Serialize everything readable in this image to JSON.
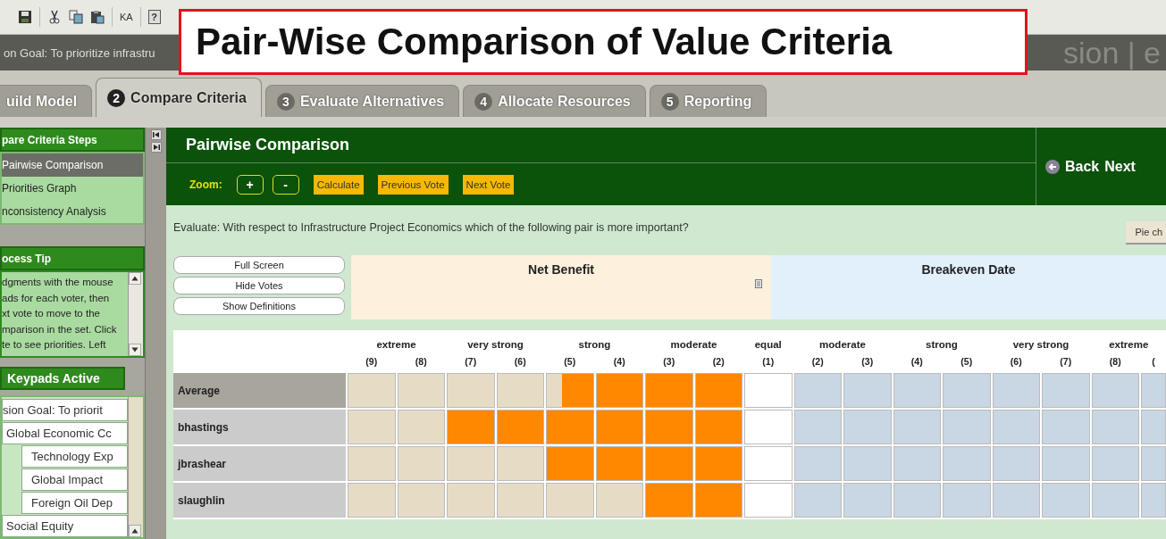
{
  "toolbar": {
    "text_buttons": [
      "KA",
      "?"
    ]
  },
  "goal_bar": {
    "text": "on Goal:  To prioritize infrastru",
    "right_text": "sion | e"
  },
  "callout": {
    "title": "Pair-Wise Comparison of Value Criteria"
  },
  "tabs": [
    {
      "label": "uild Model",
      "selected": false
    },
    {
      "number": "2",
      "label": "Compare Criteria",
      "selected": true
    },
    {
      "number": "3",
      "label": "Evaluate Alternatives",
      "selected": false
    },
    {
      "number": "4",
      "label": "Allocate Resources",
      "selected": false
    },
    {
      "number": "5",
      "label": "Reporting",
      "selected": false
    }
  ],
  "sidebar": {
    "steps_title": "pare Criteria Steps",
    "steps": [
      {
        "label": "Pairwise Comparison",
        "selected": true
      },
      {
        "label": "Priorities Graph",
        "selected": false
      },
      {
        "label": "nconsistency Analysis",
        "selected": false
      }
    ],
    "tip_title": "ocess Tip",
    "tip_lines": [
      "dgments with the mouse",
      "ads for each voter, then",
      "xt vote to move to the",
      "mparison in the set. Click",
      "te to see priorities. Left"
    ],
    "keypads_button": "Keypads Active",
    "tree": [
      {
        "label": "sion Goal:  To priorit",
        "children": [
          {
            "label": "Global Economic Cc",
            "children": [
              {
                "label": "Technology Exp"
              },
              {
                "label": "Global Impact"
              },
              {
                "label": "Foreign Oil Dep"
              }
            ]
          },
          {
            "label": "Social Equity"
          }
        ]
      }
    ]
  },
  "main": {
    "title": "Pairwise Comparison",
    "zoom_label": "Zoom:",
    "zoom_buttons": [
      "+",
      "-"
    ],
    "actions": [
      "Calculate",
      "Previous Vote",
      "Next Vote"
    ],
    "back": "Back",
    "next": "Next",
    "question": "Evaluate: With respect to Infrastructure Project Economics which of the following pair is more important?",
    "pie_button": "Pie ch",
    "view_buttons": [
      "Full Screen",
      "Hide Votes",
      "Show Definitions"
    ],
    "left_criterion": "Net Benefit",
    "right_criterion": "Breakeven Date"
  },
  "grid": {
    "groups": [
      {
        "label": "extreme",
        "kind": "level"
      },
      {
        "label": "very strong",
        "kind": "level"
      },
      {
        "label": "strong",
        "kind": "level"
      },
      {
        "label": "moderate",
        "kind": "level"
      },
      {
        "label": "equal",
        "kind": "equal"
      },
      {
        "label": "moderate",
        "kind": "level"
      },
      {
        "label": "strong",
        "kind": "level"
      },
      {
        "label": "very strong",
        "kind": "level"
      },
      {
        "label": "extreme",
        "kind": "level"
      }
    ],
    "numbers": [
      "(9)",
      "(8)",
      "(7)",
      "(6)",
      "(5)",
      "(4)",
      "(3)",
      "(2)",
      "(1)",
      "(2)",
      "(3)",
      "(4)",
      "(5)",
      "(6)",
      "(7)",
      "(8)",
      "("
    ],
    "rows": [
      {
        "name": "Average",
        "kind": "average",
        "cells": [
          {
            "filled": false,
            "partial": false
          },
          {
            "filled": false,
            "partial": false
          },
          {
            "filled": false,
            "partial": false
          },
          {
            "filled": false,
            "partial": false
          },
          {
            "filled": false,
            "partial": true
          },
          {
            "filled": true,
            "partial": false
          },
          {
            "filled": true,
            "partial": false
          },
          {
            "filled": true,
            "partial": false
          },
          {
            "filled": false,
            "partial": false
          },
          {
            "filled": false,
            "partial": false
          },
          {
            "filled": false,
            "partial": false
          },
          {
            "filled": false,
            "partial": false
          },
          {
            "filled": false,
            "partial": false
          },
          {
            "filled": false,
            "partial": false
          },
          {
            "filled": false,
            "partial": false
          },
          {
            "filled": false,
            "partial": false
          },
          {
            "filled": false,
            "partial": false
          }
        ]
      },
      {
        "name": "bhastings",
        "kind": "voter",
        "cells": [
          {
            "filled": false,
            "partial": false
          },
          {
            "filled": false,
            "partial": false
          },
          {
            "filled": true,
            "partial": false
          },
          {
            "filled": true,
            "partial": false
          },
          {
            "filled": true,
            "partial": false
          },
          {
            "filled": true,
            "partial": false
          },
          {
            "filled": true,
            "partial": false
          },
          {
            "filled": true,
            "partial": false
          },
          {
            "filled": false,
            "partial": false
          },
          {
            "filled": false,
            "partial": false
          },
          {
            "filled": false,
            "partial": false
          },
          {
            "filled": false,
            "partial": false
          },
          {
            "filled": false,
            "partial": false
          },
          {
            "filled": false,
            "partial": false
          },
          {
            "filled": false,
            "partial": false
          },
          {
            "filled": false,
            "partial": false
          },
          {
            "filled": false,
            "partial": false
          }
        ]
      },
      {
        "name": "jbrashear",
        "kind": "voter",
        "cells": [
          {
            "filled": false,
            "partial": false
          },
          {
            "filled": false,
            "partial": false
          },
          {
            "filled": false,
            "partial": false
          },
          {
            "filled": false,
            "partial": false
          },
          {
            "filled": true,
            "partial": false
          },
          {
            "filled": true,
            "partial": false
          },
          {
            "filled": true,
            "partial": false
          },
          {
            "filled": true,
            "partial": false
          },
          {
            "filled": false,
            "partial": false
          },
          {
            "filled": false,
            "partial": false
          },
          {
            "filled": false,
            "partial": false
          },
          {
            "filled": false,
            "partial": false
          },
          {
            "filled": false,
            "partial": false
          },
          {
            "filled": false,
            "partial": false
          },
          {
            "filled": false,
            "partial": false
          },
          {
            "filled": false,
            "partial": false
          },
          {
            "filled": false,
            "partial": false
          }
        ]
      },
      {
        "name": "slaughlin",
        "kind": "voter",
        "cells": [
          {
            "filled": false,
            "partial": false
          },
          {
            "filled": false,
            "partial": false
          },
          {
            "filled": false,
            "partial": false
          },
          {
            "filled": false,
            "partial": false
          },
          {
            "filled": false,
            "partial": false
          },
          {
            "filled": false,
            "partial": false
          },
          {
            "filled": true,
            "partial": false
          },
          {
            "filled": true,
            "partial": false
          },
          {
            "filled": false,
            "partial": false
          },
          {
            "filled": false,
            "partial": false
          },
          {
            "filled": false,
            "partial": false
          },
          {
            "filled": false,
            "partial": false
          },
          {
            "filled": false,
            "partial": false
          },
          {
            "filled": false,
            "partial": false
          },
          {
            "filled": false,
            "partial": false
          },
          {
            "filled": false,
            "partial": false
          },
          {
            "filled": false,
            "partial": false
          }
        ]
      }
    ]
  }
}
